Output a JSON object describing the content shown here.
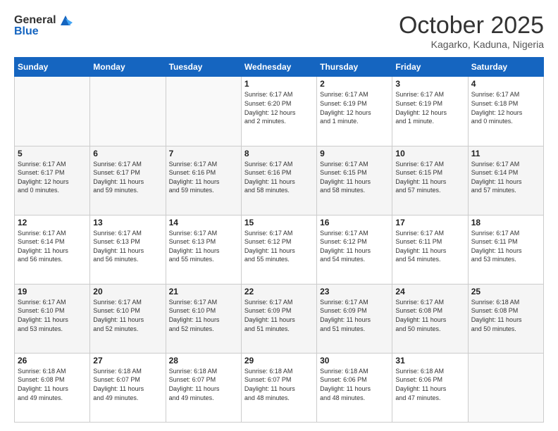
{
  "header": {
    "logo_general": "General",
    "logo_blue": "Blue",
    "month_title": "October 2025",
    "location": "Kagarko, Kaduna, Nigeria"
  },
  "calendar": {
    "days_of_week": [
      "Sunday",
      "Monday",
      "Tuesday",
      "Wednesday",
      "Thursday",
      "Friday",
      "Saturday"
    ],
    "weeks": [
      [
        {
          "day": "",
          "info": ""
        },
        {
          "day": "",
          "info": ""
        },
        {
          "day": "",
          "info": ""
        },
        {
          "day": "1",
          "info": "Sunrise: 6:17 AM\nSunset: 6:20 PM\nDaylight: 12 hours\nand 2 minutes."
        },
        {
          "day": "2",
          "info": "Sunrise: 6:17 AM\nSunset: 6:19 PM\nDaylight: 12 hours\nand 1 minute."
        },
        {
          "day": "3",
          "info": "Sunrise: 6:17 AM\nSunset: 6:19 PM\nDaylight: 12 hours\nand 1 minute."
        },
        {
          "day": "4",
          "info": "Sunrise: 6:17 AM\nSunset: 6:18 PM\nDaylight: 12 hours\nand 0 minutes."
        }
      ],
      [
        {
          "day": "5",
          "info": "Sunrise: 6:17 AM\nSunset: 6:17 PM\nDaylight: 12 hours\nand 0 minutes."
        },
        {
          "day": "6",
          "info": "Sunrise: 6:17 AM\nSunset: 6:17 PM\nDaylight: 11 hours\nand 59 minutes."
        },
        {
          "day": "7",
          "info": "Sunrise: 6:17 AM\nSunset: 6:16 PM\nDaylight: 11 hours\nand 59 minutes."
        },
        {
          "day": "8",
          "info": "Sunrise: 6:17 AM\nSunset: 6:16 PM\nDaylight: 11 hours\nand 58 minutes."
        },
        {
          "day": "9",
          "info": "Sunrise: 6:17 AM\nSunset: 6:15 PM\nDaylight: 11 hours\nand 58 minutes."
        },
        {
          "day": "10",
          "info": "Sunrise: 6:17 AM\nSunset: 6:15 PM\nDaylight: 11 hours\nand 57 minutes."
        },
        {
          "day": "11",
          "info": "Sunrise: 6:17 AM\nSunset: 6:14 PM\nDaylight: 11 hours\nand 57 minutes."
        }
      ],
      [
        {
          "day": "12",
          "info": "Sunrise: 6:17 AM\nSunset: 6:14 PM\nDaylight: 11 hours\nand 56 minutes."
        },
        {
          "day": "13",
          "info": "Sunrise: 6:17 AM\nSunset: 6:13 PM\nDaylight: 11 hours\nand 56 minutes."
        },
        {
          "day": "14",
          "info": "Sunrise: 6:17 AM\nSunset: 6:13 PM\nDaylight: 11 hours\nand 55 minutes."
        },
        {
          "day": "15",
          "info": "Sunrise: 6:17 AM\nSunset: 6:12 PM\nDaylight: 11 hours\nand 55 minutes."
        },
        {
          "day": "16",
          "info": "Sunrise: 6:17 AM\nSunset: 6:12 PM\nDaylight: 11 hours\nand 54 minutes."
        },
        {
          "day": "17",
          "info": "Sunrise: 6:17 AM\nSunset: 6:11 PM\nDaylight: 11 hours\nand 54 minutes."
        },
        {
          "day": "18",
          "info": "Sunrise: 6:17 AM\nSunset: 6:11 PM\nDaylight: 11 hours\nand 53 minutes."
        }
      ],
      [
        {
          "day": "19",
          "info": "Sunrise: 6:17 AM\nSunset: 6:10 PM\nDaylight: 11 hours\nand 53 minutes."
        },
        {
          "day": "20",
          "info": "Sunrise: 6:17 AM\nSunset: 6:10 PM\nDaylight: 11 hours\nand 52 minutes."
        },
        {
          "day": "21",
          "info": "Sunrise: 6:17 AM\nSunset: 6:10 PM\nDaylight: 11 hours\nand 52 minutes."
        },
        {
          "day": "22",
          "info": "Sunrise: 6:17 AM\nSunset: 6:09 PM\nDaylight: 11 hours\nand 51 minutes."
        },
        {
          "day": "23",
          "info": "Sunrise: 6:17 AM\nSunset: 6:09 PM\nDaylight: 11 hours\nand 51 minutes."
        },
        {
          "day": "24",
          "info": "Sunrise: 6:17 AM\nSunset: 6:08 PM\nDaylight: 11 hours\nand 50 minutes."
        },
        {
          "day": "25",
          "info": "Sunrise: 6:18 AM\nSunset: 6:08 PM\nDaylight: 11 hours\nand 50 minutes."
        }
      ],
      [
        {
          "day": "26",
          "info": "Sunrise: 6:18 AM\nSunset: 6:08 PM\nDaylight: 11 hours\nand 49 minutes."
        },
        {
          "day": "27",
          "info": "Sunrise: 6:18 AM\nSunset: 6:07 PM\nDaylight: 11 hours\nand 49 minutes."
        },
        {
          "day": "28",
          "info": "Sunrise: 6:18 AM\nSunset: 6:07 PM\nDaylight: 11 hours\nand 49 minutes."
        },
        {
          "day": "29",
          "info": "Sunrise: 6:18 AM\nSunset: 6:07 PM\nDaylight: 11 hours\nand 48 minutes."
        },
        {
          "day": "30",
          "info": "Sunrise: 6:18 AM\nSunset: 6:06 PM\nDaylight: 11 hours\nand 48 minutes."
        },
        {
          "day": "31",
          "info": "Sunrise: 6:18 AM\nSunset: 6:06 PM\nDaylight: 11 hours\nand 47 minutes."
        },
        {
          "day": "",
          "info": ""
        }
      ]
    ]
  }
}
